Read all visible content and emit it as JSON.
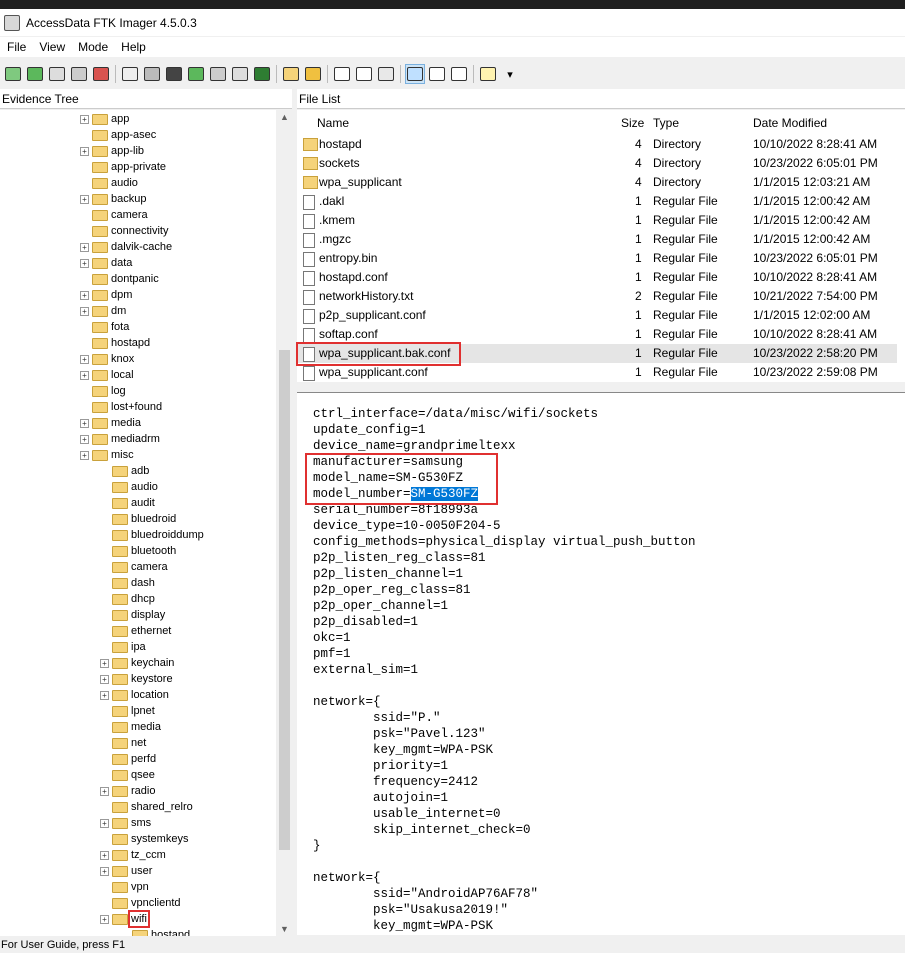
{
  "window": {
    "title": "AccessData FTK Imager 4.5.0.3"
  },
  "menu": [
    "File",
    "View",
    "Mode",
    "Help"
  ],
  "panes": {
    "tree_title": "Evidence Tree",
    "list_title": "File List"
  },
  "columns": {
    "name": "Name",
    "size": "Size",
    "type": "Type",
    "date": "Date Modified"
  },
  "files": [
    {
      "name": "hostapd",
      "size": "4",
      "type": "Directory",
      "date": "10/10/2022 8:28:41 AM",
      "icon": "folder-icon"
    },
    {
      "name": "sockets",
      "size": "4",
      "type": "Directory",
      "date": "10/23/2022 6:05:01 PM",
      "icon": "folder-icon"
    },
    {
      "name": "wpa_supplicant",
      "size": "4",
      "type": "Directory",
      "date": "1/1/2015 12:03:21 AM",
      "icon": "folder-icon"
    },
    {
      "name": ".dakl",
      "size": "1",
      "type": "Regular File",
      "date": "1/1/2015 12:00:42 AM",
      "icon": "file-icon"
    },
    {
      "name": ".kmem",
      "size": "1",
      "type": "Regular File",
      "date": "1/1/2015 12:00:42 AM",
      "icon": "file-icon"
    },
    {
      "name": ".mgzc",
      "size": "1",
      "type": "Regular File",
      "date": "1/1/2015 12:00:42 AM",
      "icon": "file-icon"
    },
    {
      "name": "entropy.bin",
      "size": "1",
      "type": "Regular File",
      "date": "10/23/2022 6:05:01 PM",
      "icon": "file-icon"
    },
    {
      "name": "hostapd.conf",
      "size": "1",
      "type": "Regular File",
      "date": "10/10/2022 8:28:41 AM",
      "icon": "file-icon"
    },
    {
      "name": "networkHistory.txt",
      "size": "2",
      "type": "Regular File",
      "date": "10/21/2022 7:54:00 PM",
      "icon": "file-icon"
    },
    {
      "name": "p2p_supplicant.conf",
      "size": "1",
      "type": "Regular File",
      "date": "1/1/2015 12:02:00 AM",
      "icon": "file-icon"
    },
    {
      "name": "softap.conf",
      "size": "1",
      "type": "Regular File",
      "date": "10/10/2022 8:28:41 AM",
      "icon": "file-icon"
    },
    {
      "name": "wpa_supplicant.bak.conf",
      "size": "1",
      "type": "Regular File",
      "date": "10/23/2022 2:58:20 PM",
      "icon": "file-icon"
    },
    {
      "name": "wpa_supplicant.conf",
      "size": "1",
      "type": "Regular File",
      "date": "10/23/2022 2:59:08 PM",
      "icon": "file-icon"
    }
  ],
  "tree": [
    {
      "label": "app",
      "exp": true,
      "level": 1
    },
    {
      "label": "app-asec",
      "exp": false,
      "level": 1
    },
    {
      "label": "app-lib",
      "exp": true,
      "level": 1
    },
    {
      "label": "app-private",
      "exp": false,
      "level": 1
    },
    {
      "label": "audio",
      "exp": false,
      "level": 1
    },
    {
      "label": "backup",
      "exp": true,
      "level": 1
    },
    {
      "label": "camera",
      "exp": false,
      "level": 1
    },
    {
      "label": "connectivity",
      "exp": false,
      "level": 1
    },
    {
      "label": "dalvik-cache",
      "exp": true,
      "level": 1
    },
    {
      "label": "data",
      "exp": true,
      "level": 1
    },
    {
      "label": "dontpanic",
      "exp": false,
      "level": 1
    },
    {
      "label": "dpm",
      "exp": true,
      "level": 1
    },
    {
      "label": "dm",
      "exp": true,
      "level": 1
    },
    {
      "label": "fota",
      "exp": false,
      "level": 1
    },
    {
      "label": "hostapd",
      "exp": false,
      "level": 1
    },
    {
      "label": "knox",
      "exp": true,
      "level": 1
    },
    {
      "label": "local",
      "exp": true,
      "level": 1
    },
    {
      "label": "log",
      "exp": false,
      "level": 1
    },
    {
      "label": "lost+found",
      "exp": false,
      "level": 1
    },
    {
      "label": "media",
      "exp": true,
      "level": 1
    },
    {
      "label": "mediadrm",
      "exp": true,
      "level": 1
    },
    {
      "label": "misc",
      "exp": true,
      "level": 1
    },
    {
      "label": "adb",
      "exp": false,
      "level": 2
    },
    {
      "label": "audio",
      "exp": false,
      "level": 2
    },
    {
      "label": "audit",
      "exp": false,
      "level": 2
    },
    {
      "label": "bluedroid",
      "exp": false,
      "level": 2
    },
    {
      "label": "bluedroiddump",
      "exp": false,
      "level": 2
    },
    {
      "label": "bluetooth",
      "exp": false,
      "level": 2
    },
    {
      "label": "camera",
      "exp": false,
      "level": 2
    },
    {
      "label": "dash",
      "exp": false,
      "level": 2
    },
    {
      "label": "dhcp",
      "exp": false,
      "level": 2
    },
    {
      "label": "display",
      "exp": false,
      "level": 2
    },
    {
      "label": "ethernet",
      "exp": false,
      "level": 2
    },
    {
      "label": "ipa",
      "exp": false,
      "level": 2
    },
    {
      "label": "keychain",
      "exp": true,
      "level": 2
    },
    {
      "label": "keystore",
      "exp": true,
      "level": 2
    },
    {
      "label": "location",
      "exp": true,
      "level": 2
    },
    {
      "label": "lpnet",
      "exp": false,
      "level": 2
    },
    {
      "label": "media",
      "exp": false,
      "level": 2
    },
    {
      "label": "net",
      "exp": false,
      "level": 2
    },
    {
      "label": "perfd",
      "exp": false,
      "level": 2
    },
    {
      "label": "qsee",
      "exp": false,
      "level": 2
    },
    {
      "label": "radio",
      "exp": true,
      "level": 2
    },
    {
      "label": "shared_relro",
      "exp": false,
      "level": 2
    },
    {
      "label": "sms",
      "exp": true,
      "level": 2
    },
    {
      "label": "systemkeys",
      "exp": false,
      "level": 2
    },
    {
      "label": "tz_ccm",
      "exp": true,
      "level": 2
    },
    {
      "label": "user",
      "exp": true,
      "level": 2
    },
    {
      "label": "vpn",
      "exp": false,
      "level": 2
    },
    {
      "label": "vpnclientd",
      "exp": false,
      "level": 2
    },
    {
      "label": "wifi",
      "exp": true,
      "level": 2,
      "selected": true
    },
    {
      "label": "hostapd",
      "exp": false,
      "level": 3
    }
  ],
  "content": {
    "before_selection": "ctrl_interface=/data/misc/wifi/sockets\nupdate_config=1\ndevice_name=grandprimeltexx\nmanufacturer=samsung\nmodel_name=SM-G530FZ\nmodel_number=",
    "selection": "SM-G530FZ",
    "after_selection": "\nserial_number=8f18993a\ndevice_type=10-0050F204-5\nconfig_methods=physical_display virtual_push_button\np2p_listen_reg_class=81\np2p_listen_channel=1\np2p_oper_reg_class=81\np2p_oper_channel=1\np2p_disabled=1\nokc=1\npmf=1\nexternal_sim=1\n\nnetwork={\n        ssid=\"P.\"\n        psk=\"Pavel.123\"\n        key_mgmt=WPA-PSK\n        priority=1\n        frequency=2412\n        autojoin=1\n        usable_internet=0\n        skip_internet_check=0\n}\n\nnetwork={\n        ssid=\"AndroidAP76AF78\"\n        psk=\"Usakusa2019!\"\n        key_mgmt=WPA-PSK"
  },
  "status": {
    "text": "For User Guide, press F1"
  }
}
